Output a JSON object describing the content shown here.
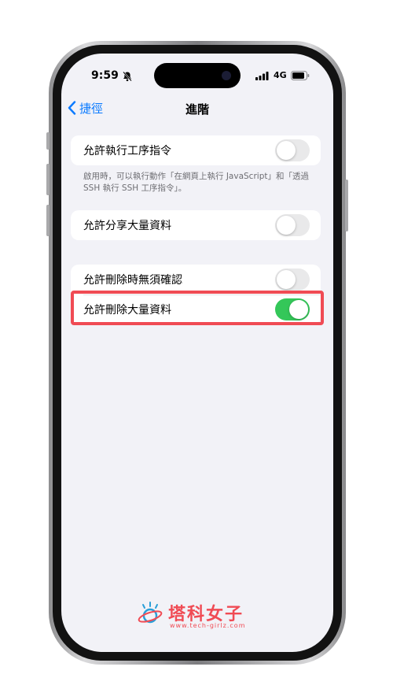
{
  "status_bar": {
    "time": "9:59",
    "network": "4G"
  },
  "nav": {
    "back_label": "捷徑",
    "title": "進階"
  },
  "settings": {
    "run_scripts": {
      "label": "允許執行工序指令",
      "enabled": false
    },
    "run_scripts_footnote": "啟用時，可以執行動作「在網頁上執行 JavaScript」和「透過 SSH 執行 SSH 工序指令」。",
    "share_large": {
      "label": "允許分享大量資料",
      "enabled": false
    },
    "delete_no_confirm": {
      "label": "允許刪除時無須確認",
      "enabled": false
    },
    "delete_large": {
      "label": "允許刪除大量資料",
      "enabled": true
    }
  },
  "colors": {
    "accent": "#0a7aff",
    "toggle_on": "#34c759",
    "highlight": "#f04b54"
  },
  "watermark": {
    "brand": "塔科女子",
    "site": "www.tech-girlz.com"
  }
}
